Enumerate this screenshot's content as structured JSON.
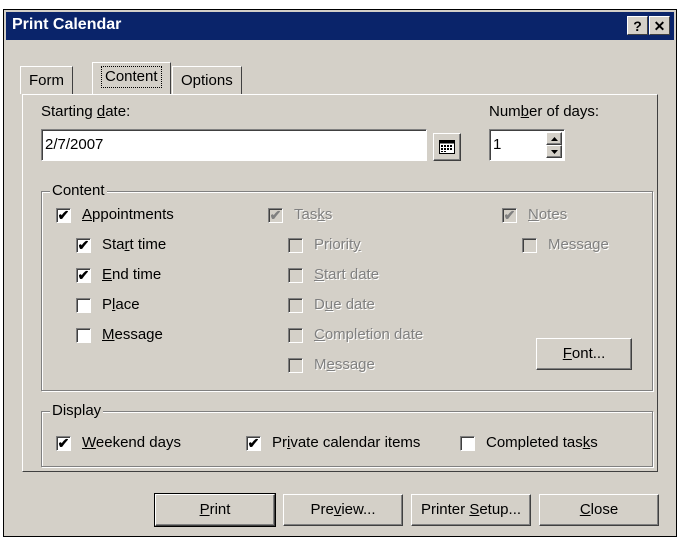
{
  "window": {
    "title": "Print Calendar",
    "help_btn": "?",
    "close_btn": "✕"
  },
  "tabs": [
    {
      "label": "Form"
    },
    {
      "label": "Content"
    },
    {
      "label": "Options"
    }
  ],
  "starting_date": {
    "label_pre": "Starting ",
    "label_u": "d",
    "label_post": "ate:",
    "value": "2/7/2007"
  },
  "number_of_days": {
    "label_pre": "Num",
    "label_u": "b",
    "label_post": "er of days:",
    "value": "1"
  },
  "content_group": {
    "label": "Content",
    "appointments": {
      "pre": "",
      "u": "A",
      "post": "ppointments",
      "checked": "✔"
    },
    "start_time": {
      "pre": "Sta",
      "u": "r",
      "post": "t time",
      "checked": "✔"
    },
    "end_time": {
      "pre": "",
      "u": "E",
      "post": "nd time",
      "checked": "✔"
    },
    "place": {
      "pre": "P",
      "u": "l",
      "post": "ace",
      "checked": ""
    },
    "appt_message": {
      "pre": "",
      "u": "M",
      "post": "essage",
      "checked": ""
    },
    "tasks": {
      "pre": "Tas",
      "u": "k",
      "post": "s",
      "checked": "✔"
    },
    "priority": {
      "pre": "Priorit",
      "u": "y",
      "post": "",
      "checked": ""
    },
    "start_date": {
      "pre": "",
      "u": "S",
      "post": "tart date",
      "checked": ""
    },
    "due_date": {
      "pre": "D",
      "u": "u",
      "post": "e date",
      "checked": ""
    },
    "completion_date": {
      "pre": "",
      "u": "C",
      "post": "ompletion date",
      "checked": ""
    },
    "task_message": {
      "pre": "M",
      "u": "e",
      "post": "ssage",
      "checked": ""
    },
    "notes": {
      "pre": "",
      "u": "N",
      "post": "otes",
      "checked": "✔"
    },
    "notes_message": {
      "pre": "Message",
      "u": "",
      "post": "",
      "checked": ""
    },
    "font_button": {
      "pre": "",
      "u": "F",
      "post": "ont..."
    }
  },
  "display_group": {
    "label": "Display",
    "weekend_days": {
      "pre": "",
      "u": "W",
      "post": "eekend days",
      "checked": "✔"
    },
    "private_items": {
      "pre": "Pr",
      "u": "i",
      "post": "vate calendar items",
      "checked": "✔"
    },
    "completed_tasks": {
      "pre": "Completed tas",
      "u": "k",
      "post": "s",
      "checked": ""
    }
  },
  "buttons": {
    "print": {
      "pre": "",
      "u": "P",
      "post": "rint"
    },
    "preview": {
      "pre": "Pre",
      "u": "v",
      "post": "iew..."
    },
    "printer_setup": {
      "pre": "Printer ",
      "u": "S",
      "post": "etup..."
    },
    "close": {
      "pre": "",
      "u": "C",
      "post": "lose"
    }
  },
  "colors": {
    "titlebar": "#0a246a",
    "face": "#d4d0c8",
    "disabled_text": "#808080"
  }
}
